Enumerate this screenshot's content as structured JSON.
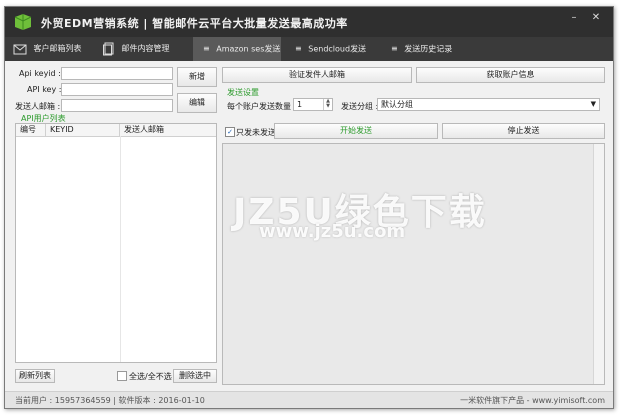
{
  "app": {
    "title": "外贸EDM营销系统 | 智能邮件云平台大批量发送最高成功率"
  },
  "tabs": [
    {
      "label": "客户邮箱列表",
      "icon": "mail-icon",
      "active": false
    },
    {
      "label": "邮件内容管理",
      "icon": "document-icon",
      "active": false
    },
    {
      "label": "Amazon ses发送",
      "icon": "menu-icon",
      "active": true
    },
    {
      "label": "Sendcloud发送",
      "icon": "menu-icon",
      "active": false
    },
    {
      "label": "发送历史记录",
      "icon": "menu-icon",
      "active": false
    }
  ],
  "left": {
    "api_keyid_label": "Api keyid :",
    "api_key_label": "API key :",
    "sender_email_label": "发送人邮箱 :",
    "api_keyid_value": "",
    "api_key_value": "",
    "sender_email_value": "",
    "add_button": "新增",
    "edit_button": "编辑",
    "list_title": "API用户列表",
    "columns": [
      "编号",
      "KEYID",
      "发送人邮箱"
    ],
    "rows": [],
    "refresh_button": "刷新列表",
    "select_all_label": "全选/全不选",
    "select_all_checked": false,
    "delete_button": "删除选中"
  },
  "right": {
    "verify_button": "验证发件人邮箱",
    "account_info_button": "获取账户信息",
    "settings_title": "发送设置",
    "per_account_label": "每个账户发送数量 :",
    "per_account_value": "1",
    "group_label": "发送分组 :",
    "group_value": "默认分组",
    "only_unsent_label": "只发未发送",
    "only_unsent_checked": true,
    "start_button": "开始发送",
    "stop_button": "停止发送"
  },
  "status": {
    "user_text": "当前用户 : 15957364559 | 软件版本 : 2016-01-10",
    "vendor_text": "一米软件旗下产品 - www.yimisoft.com"
  },
  "watermark": {
    "line1": "JZ5U绿色下载",
    "line2": "www.jz5u.com"
  },
  "colors": {
    "titlebar": "#2f2f2f",
    "tabbar": "#3a3a3a",
    "active_tab": "#5a5a5a",
    "accent_green": "#2b9a2b"
  }
}
